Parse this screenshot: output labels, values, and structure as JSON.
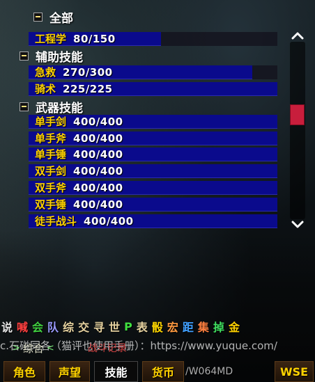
{
  "categories": {
    "all": "全部",
    "secondary": "辅助技能",
    "weapon": "武器技能"
  },
  "skills": [
    {
      "name": "工程学",
      "value": "80/150",
      "progress": 0.5333
    },
    {
      "name": "急救",
      "value": "270/300",
      "progress": 0.9
    },
    {
      "name": "骑术",
      "value": "225/225",
      "progress": 1.0
    },
    {
      "name": "单手剑",
      "value": "400/400",
      "progress": 1.0
    },
    {
      "name": "单手斧",
      "value": "400/400",
      "progress": 1.0
    },
    {
      "name": "单手锤",
      "value": "400/400",
      "progress": 1.0
    },
    {
      "name": "双手剑",
      "value": "400/400",
      "progress": 1.0
    },
    {
      "name": "双手斧",
      "value": "400/400",
      "progress": 1.0
    },
    {
      "name": "双手锤",
      "value": "400/400",
      "progress": 1.0
    },
    {
      "name": "徒手战斗",
      "value": "400/400",
      "progress": 1.0
    }
  ],
  "scroll": {
    "up_icon": "chevron-up-icon",
    "down_icon": "chevron-down-icon",
    "thumb_color": "#c81e3c"
  },
  "chat_channels": [
    {
      "label": "说",
      "color": "#e6e6e6"
    },
    {
      "label": "喊",
      "color": "#ff4040"
    },
    {
      "label": "会",
      "color": "#40d040"
    },
    {
      "label": "队",
      "color": "#9a9aff"
    },
    {
      "label": "综",
      "color": "#e6d2a0"
    },
    {
      "label": "交",
      "color": "#e6d2a0"
    },
    {
      "label": "寻",
      "color": "#e6d2a0"
    },
    {
      "label": "世",
      "color": "#e6d2a0"
    },
    {
      "label": "P",
      "color": "#40e040"
    },
    {
      "label": "表",
      "color": "#e6d2a0"
    },
    {
      "label": "骰",
      "color": "#ffd700"
    },
    {
      "label": "宏",
      "color": "#ff9a40"
    },
    {
      "label": "距",
      "color": "#40a0ff"
    },
    {
      "label": "集",
      "color": "#ff8040"
    },
    {
      "label": "掉",
      "color": "#40e060"
    },
    {
      "label": "金",
      "color": "#ffd200"
    }
  ],
  "chat": {
    "tab_all": "综合",
    "tab_combat": "战斗记录",
    "message_prefix": "c.石碰同各（猫评也使用手册）：https://www.yuque.com/",
    "message_suffix": ""
  },
  "bottom_tabs": [
    {
      "label": "角色"
    },
    {
      "label": "声望"
    },
    {
      "label": "技能"
    },
    {
      "label": "货币"
    },
    {
      "label": "/W064MD"
    },
    {
      "label": "WSE"
    }
  ]
}
